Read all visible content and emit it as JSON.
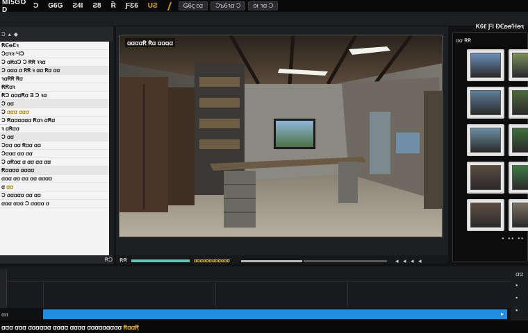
{
  "app": {
    "title": "ṀI5GO D"
  },
  "menu": [
    {
      "label": "Ɔ",
      "accent": false
    },
    {
      "label": "Ǥ6Ǥ",
      "accent": false
    },
    {
      "label": "Ƨ4I",
      "accent": false
    },
    {
      "label": "Ƨ8",
      "accent": false
    },
    {
      "label": "Ȑ",
      "accent": false
    },
    {
      "label": "ƑƐ6",
      "accent": false
    },
    {
      "label": "UƧ",
      "accent": true
    }
  ],
  "top_buttons": [
    "Ǥ6ꞔ ϵꭤ",
    "Ɔꙏ6ꝛꭤ Ɔ",
    "ꙕ ꝛꭤ Ɔ"
  ],
  "right_label": "Ƙ6ℓ ƑƖ ƉꞒꞝꝋꞪꝋꝛ",
  "left_panel": {
    "tabs": [
      "Ɔ",
      "▴",
      "◆"
    ],
    "rows": [
      {
        "text": "ꞦꞒꝋƐꝛ",
        "yellow": "",
        "grey": false
      },
      {
        "text": "Ɔꭤꝛꝛ꞉ꞍƆ",
        "yellow": "",
        "grey": false
      },
      {
        "text": "Ɔ ꭤꞢꭤƆ Ɔ ꞦꞦ ꝛꝛꭤ",
        "yellow": "",
        "grey": false
      },
      {
        "text": "Ɔ ꭤꭤꭤ ꭤ ꞦꞦ ꝛ ꭤꭤ Ꞧꭤ ꭤꭤ",
        "yellow": "",
        "grey": true
      },
      {
        "text": "ꝛꭤꞦꞦ Ꞧꭤ",
        "yellow": "",
        "grey": false
      },
      {
        "text": "ꞦꞦꭤꝛ",
        "yellow": "",
        "grey": false
      },
      {
        "text": "ꞦƆ ꭤꭤꭤꞦꭤ Ǝ Ɔ ꝛꭤ",
        "yellow": "",
        "grey": false
      },
      {
        "text": "Ɔ ꭤꭤ",
        "yellow": "",
        "grey": true
      },
      {
        "text": "Ɔ ",
        "yellow": "ꭤꭤꭤ ꭤꭤꭤ",
        "grey": false
      },
      {
        "text": "Ɔ Ꞧꭤꭤꭤꭤꭤꭤ Ꞧꭤꝛ ꭤꞦꭤ",
        "yellow": "",
        "grey": false
      },
      {
        "text": "ꝛ ꭤꞦꭤꭤ",
        "yellow": "",
        "grey": false
      },
      {
        "text": "Ɔ ꭤꭤ",
        "yellow": "",
        "grey": true
      },
      {
        "text": "Ɔꭤꭤ ꭤꭤ Ꞧꭤꭤ ꭤꭤ",
        "yellow": "",
        "grey": false
      },
      {
        "text": "Ɔꭤꭤꭤ ꭤꭤ ꭤꭤ",
        "yellow": "",
        "grey": false
      },
      {
        "text": "Ɔ ꭤꞦꭤꭤ ꭤ ꭤꭤ ꭤꭤ ꭤꭤ",
        "yellow": "",
        "grey": false
      },
      {
        "text": "Ꞧꭤꭤꭤꭤ ꭤꭤꭤꭤ",
        "yellow": "",
        "grey": true
      },
      {
        "text": "ꭤꭤꭤ ꭤꭤ ꭤꭤ ꭤꭤ ꭤꭤꭤꭤ",
        "yellow": "",
        "grey": false
      },
      {
        "text": "ꭤ ",
        "yellow": "ꭤꭤ",
        "grey": false
      },
      {
        "text": "Ɔ ꭤꭤꭤꭤꭤ ꭤꭤ ꭤꭤ",
        "yellow": "",
        "grey": false
      },
      {
        "text": "ꭤꭤꭤ ꭤꭤꭤ Ɔ ꭤꭤꭤꭤ ꭤ",
        "yellow": "",
        "grey": false
      }
    ],
    "footer_left": "",
    "footer_right": "ꞦƆ"
  },
  "viewer": {
    "title": "ꭤꭤꭤꭤꞦ Ꞧꭤ ꭤꭤꭤꭤ",
    "timecode": "ꞦꞦ",
    "segment_label": "ꭤꭤꭤꭤꭤꭤꭤꭤꭤꭤꭤꭤ",
    "nav_arrows": "◂ ◂ ◂ ◂"
  },
  "right_panel": {
    "tab": "ꭤꭤ ꞦꞦ",
    "footer": "▪ ▪▪ ▪▪",
    "thumbnails": [
      {
        "name": "thumb-river",
        "color": "#6b8fb8"
      },
      {
        "name": "thumb-field",
        "color": "#7a8f5a"
      },
      {
        "name": "thumb-hills",
        "color": "#5e7f9a"
      },
      {
        "name": "thumb-forest",
        "color": "#4a6a3a"
      },
      {
        "name": "thumb-valley",
        "color": "#6c8fa2"
      },
      {
        "name": "thumb-green",
        "color": "#3f6e3c"
      },
      {
        "name": "thumb-room",
        "color": "#5a4c3e"
      },
      {
        "name": "thumb-garden",
        "color": "#3e7a42"
      },
      {
        "name": "thumb-cabinet",
        "color": "#5e4e40"
      },
      {
        "name": "thumb-shed",
        "color": "#7a7060"
      }
    ]
  },
  "tracks": {
    "left_label": "ꭤꭤ",
    "right_icons": [
      "ꭤꭤ",
      "▪",
      "▪",
      "▪"
    ]
  },
  "status": {
    "text": "ꭤꭤꭤ ꭤꭤꭤ ꭤꭤꭤꭤꭤꭤ ꭤꭤꭤꭤ ꭤꭤꭤꭤ ꭤꭤꭤꭤꭤꭤꭤꭤꭤ",
    "accent": "ꞦꭤꭤꞦ"
  }
}
